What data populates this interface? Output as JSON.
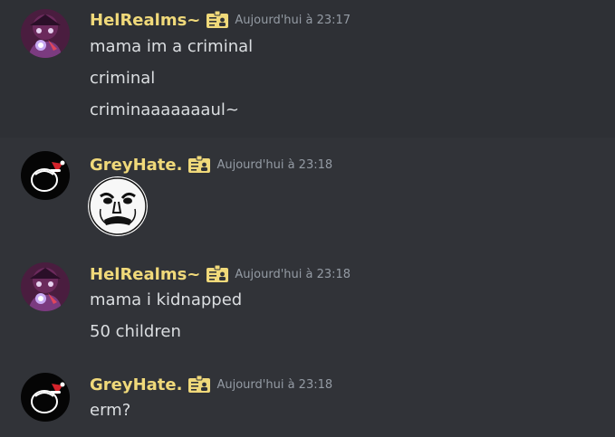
{
  "messages": [
    {
      "username": "HelRealms~",
      "timestamp": "Aujourd'hui à 23:17",
      "lines": [
        "mama im a criminal",
        "criminal",
        "criminaaaaaaaul~"
      ]
    },
    {
      "username": "GreyHate.",
      "timestamp": "Aujourd'hui à 23:18",
      "sticker": "meme-face-sticker"
    },
    {
      "username": "HelRealms~",
      "timestamp": "Aujourd'hui à 23:18",
      "lines": [
        "mama i kidnapped",
        "50 children"
      ]
    },
    {
      "username": "GreyHate.",
      "timestamp": "Aujourd'hui à 23:18",
      "lines": [
        "erm?"
      ]
    }
  ],
  "colors": {
    "background": "#313338",
    "username": "#f0d97a",
    "timestamp": "#949ba4",
    "text": "#dbdee1"
  },
  "icons": {
    "badge": "id-card-badge-icon",
    "avatar_helrealms": "purple-character-avatar",
    "avatar_greyhate": "black-santa-hat-avatar"
  }
}
